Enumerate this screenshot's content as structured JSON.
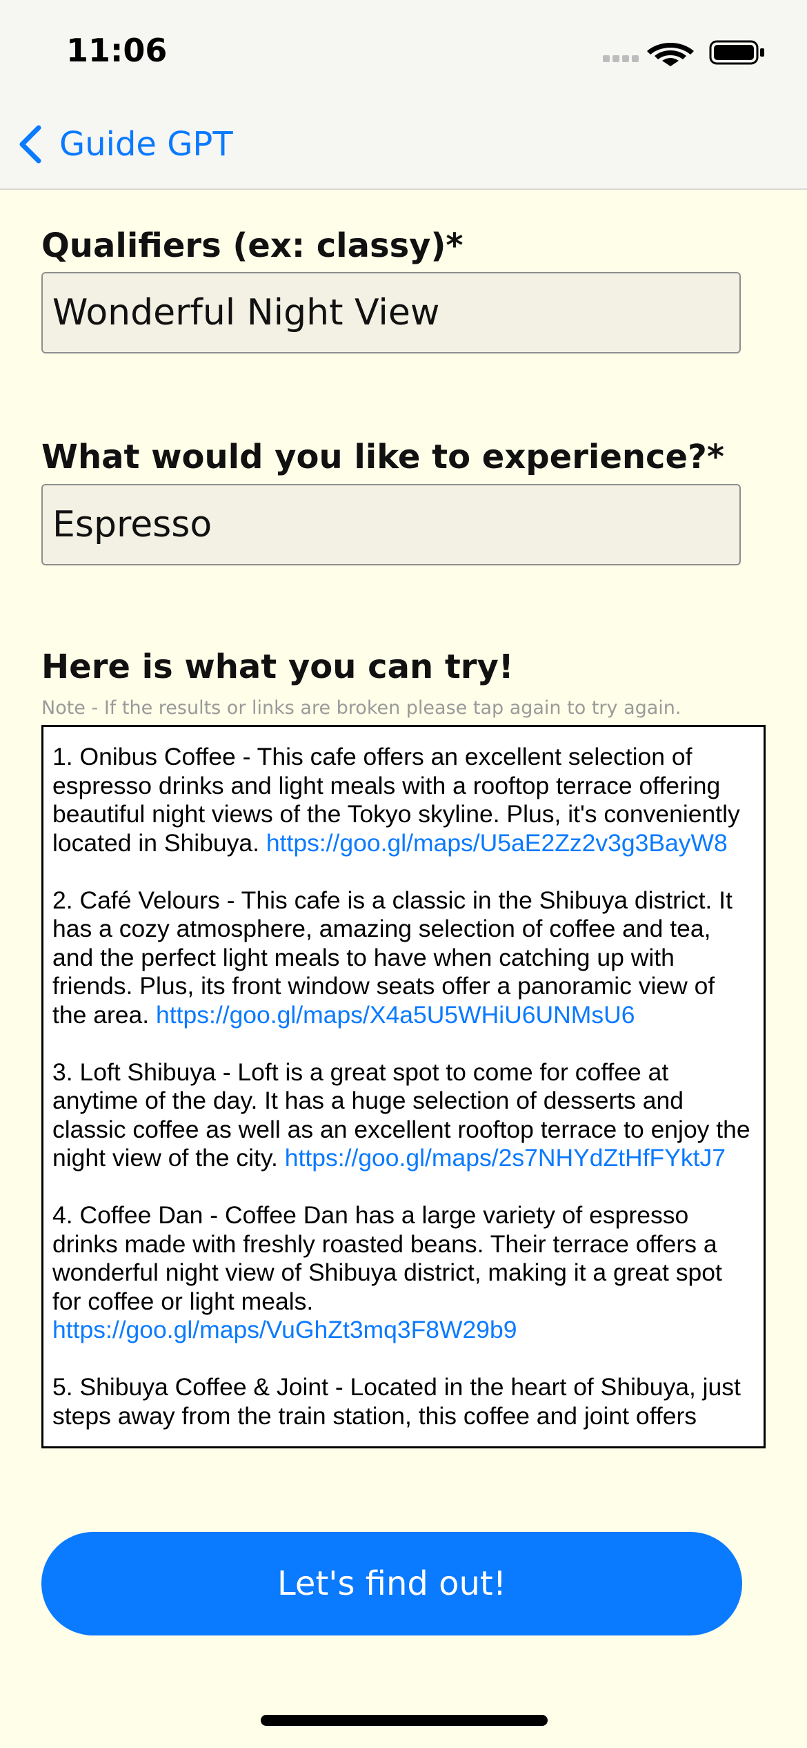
{
  "status_bar": {
    "time": "11:06"
  },
  "nav": {
    "back_label": "Guide GPT"
  },
  "form": {
    "qualifiers_label": "Qualifiers (ex: classy)*",
    "qualifiers_value": "Wonderful Night View",
    "experience_label": "What would you like to experience?*",
    "experience_value": "Espresso"
  },
  "results": {
    "title": "Here is what you can try!",
    "note": "Note - If the results or links are broken please tap again to try again.",
    "items": [
      {
        "text": "1. Onibus Coffee - This cafe offers an excellent selection of espresso drinks and light meals with a rooftop terrace offering beautiful night views of the Tokyo skyline. Plus, it's conveniently located in Shibuya.",
        "link": "https://goo.gl/maps/U5aE2Zz2v3g3BayW8"
      },
      {
        "text": "2. Café Velours - This cafe is a classic in the Shibuya district. It has a cozy atmosphere, amazing selection of coffee and tea, and the perfect light meals to have when catching up with friends. Plus, its front window seats offer a panoramic view of the area.",
        "link": "https://goo.gl/maps/X4a5U5WHiU6UNMsU6"
      },
      {
        "text": "3. Loft Shibuya - Loft is a great spot to come for coffee at anytime of the day. It has a huge selection of desserts and classic coffee as well as an excellent rooftop terrace to enjoy the night view of the city.",
        "link": "https://goo.gl/maps/2s7NHYdZtHfFYktJ7"
      },
      {
        "text": "4. Coffee Dan - Coffee Dan has a large variety of espresso drinks made with freshly roasted beans. Their terrace offers a wonderful night view of Shibuya district, making it a great spot for coffee or light meals.",
        "link": "https://goo.gl/maps/VuGhZt3mq3F8W29b9"
      },
      {
        "text": "5. Shibuya Coffee & Joint - Located in the heart of Shibuya, just steps away from the train station, this coffee and joint offers",
        "link": ""
      }
    ]
  },
  "cta": {
    "label": "Let's find out!"
  },
  "colors": {
    "accent": "#0a7aff",
    "background": "#fffee9",
    "input_bg": "#f2f1e3"
  }
}
